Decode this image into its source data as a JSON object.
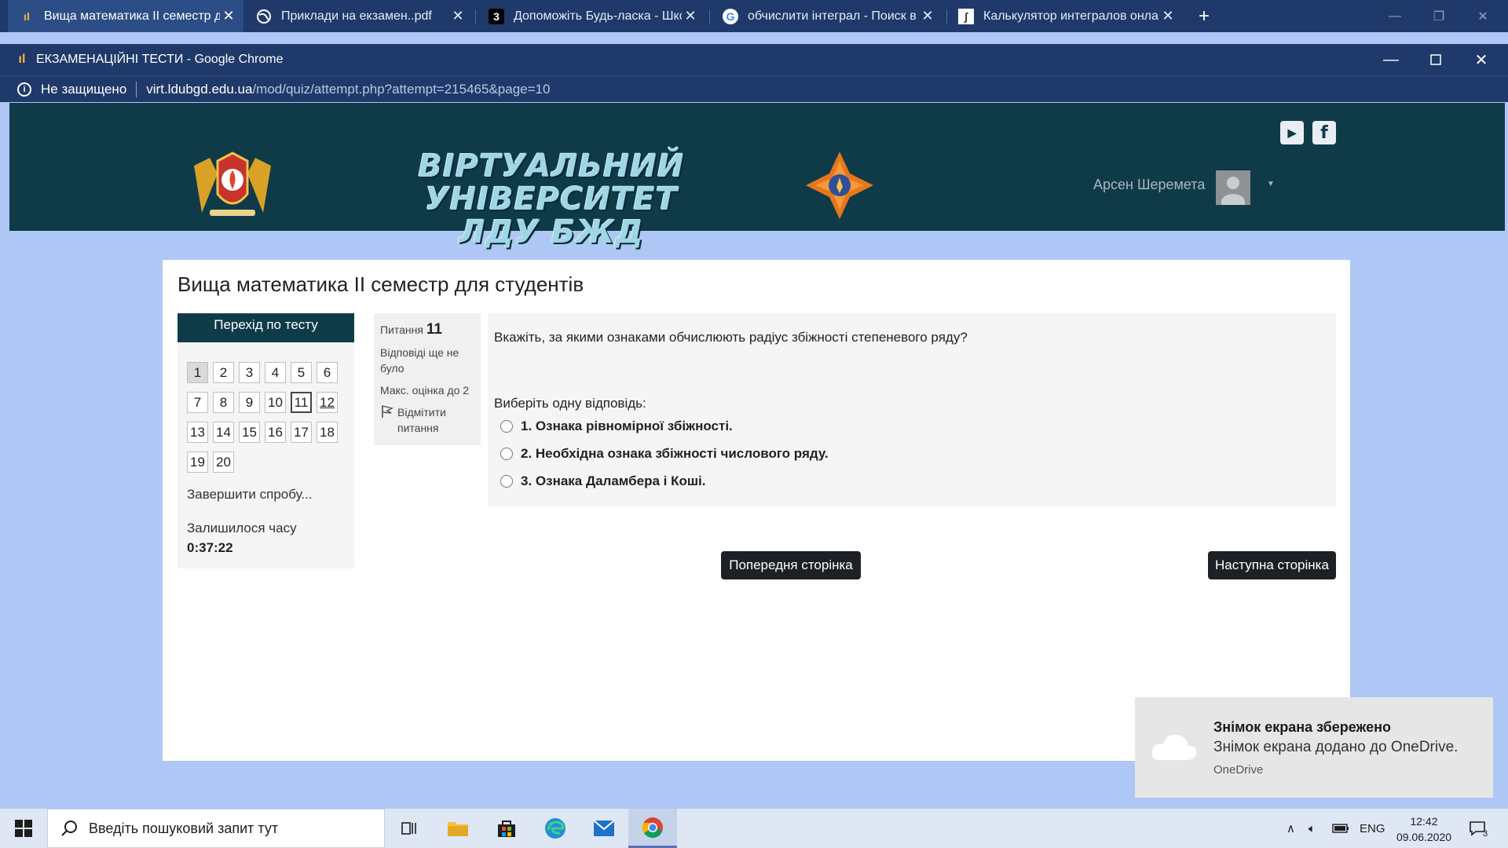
{
  "browser_tabs": [
    {
      "title": "Вища математика ІІ семестр для студентів",
      "active": true
    },
    {
      "title": "Приклади на екзамен..pdf",
      "active": false
    },
    {
      "title": "Допоможіть Будь-ласка - Школа",
      "active": false
    },
    {
      "title": "обчислити інтеграл - Поиск в Google",
      "active": false
    },
    {
      "title": "Калькулятор интегралов онлайн",
      "active": false
    }
  ],
  "popup": {
    "window_title": "ЕКЗАМЕНАЦІЙНІ ТЕСТИ - Google Chrome",
    "security_label": "Не защищено",
    "url_host": "virt.ldubgd.edu.ua",
    "url_path": "/mod/quiz/attempt.php?attempt=215465&page=10"
  },
  "site": {
    "banner_line1": "ВІРТУАЛЬНИЙ УНІВЕРСИТЕТ",
    "banner_line2": "ЛДУ БЖД",
    "social": [
      "youtube-icon",
      "facebook-icon"
    ],
    "user_name": "Арсен Шеремета"
  },
  "page": {
    "title": "Вища математика ІІ семестр для студентів"
  },
  "quiz_nav": {
    "heading": "Перехід по тесту",
    "questions": [
      "1",
      "2",
      "3",
      "4",
      "5",
      "6",
      "7",
      "8",
      "9",
      "10",
      "11",
      "12",
      "13",
      "14",
      "15",
      "16",
      "17",
      "18",
      "19",
      "20"
    ],
    "current_page_question": "11",
    "finish_label": "Завершити спробу...",
    "time_label": "Залишилося часу",
    "time_value": "0:37:22"
  },
  "question": {
    "number_label": "Питання",
    "number": "11",
    "state": "Відповіді ще не було",
    "grade": "Макс. оцінка до 2",
    "flag_label": "Відмітити питання",
    "text": "Вкажіть, за якими ознаками обчислюють радіус збіжності степеневого ряду?",
    "prompt": "Виберіть одну відповідь:",
    "options": [
      "1. Ознака рівномірної збіжності.",
      "2. Необхідна ознака збіжності  числового ряду.",
      "3. Ознака Даламбера і Коші."
    ]
  },
  "nav_buttons": {
    "prev": "Попередня сторінка",
    "next": "Наступна сторінка"
  },
  "toast": {
    "title": "Знімок екрана збережено",
    "body": "Знімок екрана додано до OneDrive.",
    "source": "OneDrive"
  },
  "taskbar": {
    "search_placeholder": "Введіть пошуковий запит тут",
    "language": "ENG",
    "time": "12:42",
    "date": "09.06.2020",
    "notification_count": "3"
  },
  "colors": {
    "header_bg": "#0f3b49",
    "page_bg": "#aec7f4",
    "chrome_bar": "#1f3a6a"
  }
}
